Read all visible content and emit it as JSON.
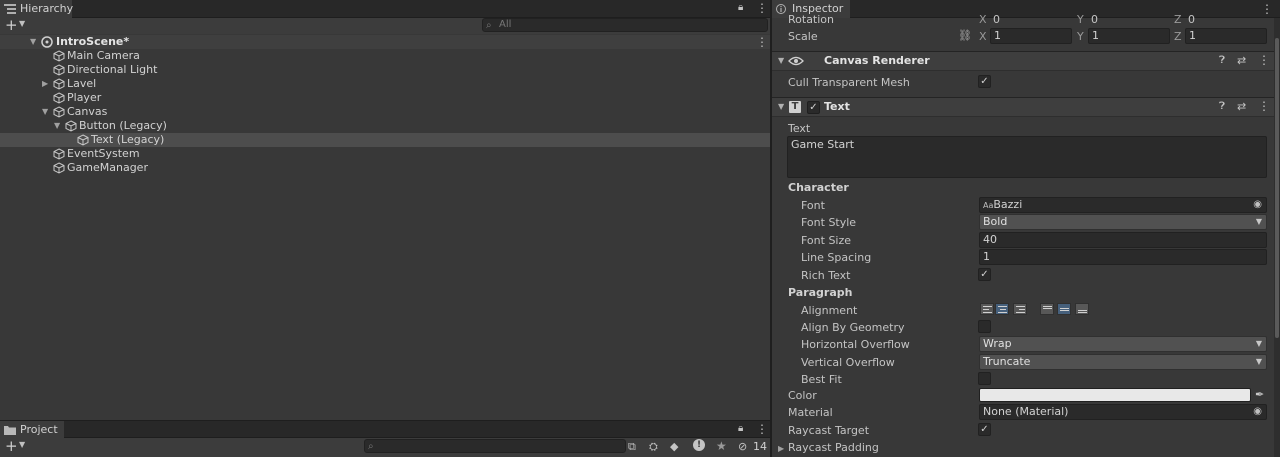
{
  "hierarchy": {
    "tab_label": "Hierarchy",
    "search_placeholder": "All",
    "add_label": "+",
    "scene_name": "IntroScene*",
    "items": [
      {
        "label": "Main Camera"
      },
      {
        "label": "Directional Light"
      },
      {
        "label": "Lavel"
      },
      {
        "label": "Player"
      },
      {
        "label": "Canvas"
      },
      {
        "label": "Button (Legacy)"
      },
      {
        "label": "Text (Legacy)"
      },
      {
        "label": "EventSystem"
      },
      {
        "label": "GameManager"
      }
    ]
  },
  "project": {
    "tab_label": "Project",
    "add_label": "+",
    "hidden_count": "14"
  },
  "inspector": {
    "tab_label": "Inspector",
    "transform": {
      "rotation_label": "Rotation",
      "rotation": {
        "x": "0",
        "y": "0",
        "z": "0"
      },
      "scale_label": "Scale",
      "scale": {
        "x": "1",
        "y": "1",
        "z": "1"
      },
      "x_label": "X",
      "y_label": "Y",
      "z_label": "Z"
    },
    "canvas_renderer": {
      "title": "Canvas Renderer",
      "cull_label": "Cull Transparent Mesh"
    },
    "text": {
      "title": "Text",
      "text_label": "Text",
      "text_value": "Game Start",
      "character_header": "Character",
      "font_label": "Font",
      "font_prefix": "Aa",
      "font_value": "Bazzi",
      "font_style_label": "Font Style",
      "font_style_value": "Bold",
      "font_size_label": "Font Size",
      "font_size_value": "40",
      "line_spacing_label": "Line Spacing",
      "line_spacing_value": "1",
      "rich_text_label": "Rich Text",
      "paragraph_header": "Paragraph",
      "alignment_label": "Alignment",
      "align_by_geometry_label": "Align By Geometry",
      "h_overflow_label": "Horizontal Overflow",
      "h_overflow_value": "Wrap",
      "v_overflow_label": "Vertical Overflow",
      "v_overflow_value": "Truncate",
      "best_fit_label": "Best Fit",
      "color_label": "Color",
      "color_value": "#e8e8e8",
      "material_label": "Material",
      "material_value": "None (Material)",
      "raycast_target_label": "Raycast Target",
      "raycast_padding_label": "Raycast Padding"
    }
  },
  "colors": {
    "accent": "#46607c",
    "panel": "#383838",
    "selection": "#4d4d4d"
  }
}
